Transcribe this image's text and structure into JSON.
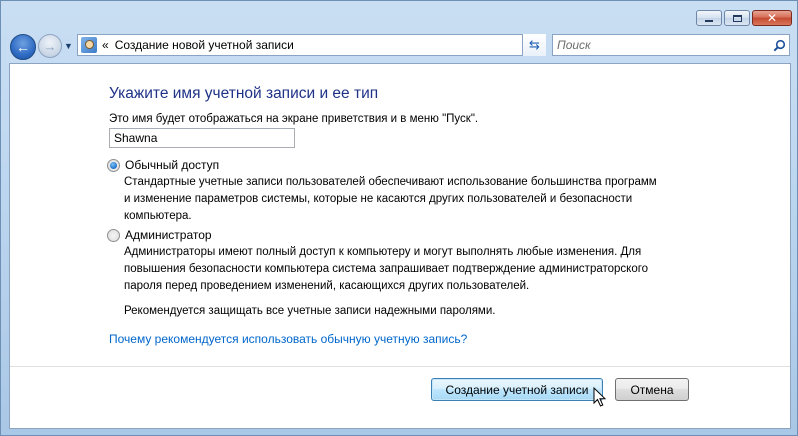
{
  "window": {
    "caption_buttons": [
      "minimize",
      "maximize",
      "close"
    ]
  },
  "navigation": {
    "address": "Создание новой учетной записи",
    "breadcrumb_chevrons": "«",
    "search_placeholder": "Поиск"
  },
  "main": {
    "title": "Укажите имя учетной записи и ее тип",
    "subtitle": "Это имя будет отображаться на экране приветствия и в меню \"Пуск\".",
    "name_value": "Shawna",
    "options": [
      {
        "label": "Обычный доступ",
        "checked": true,
        "description": [
          "Стандартные учетные записи пользователей обеспечивают использование большинства программ",
          "и изменение параметров системы, которые не касаются других пользователей и безопасности",
          "компьютера."
        ]
      },
      {
        "label": "Администратор",
        "checked": false,
        "description": [
          "Администраторы имеют полный доступ к компьютеру и могут выполнять любые изменения. Для",
          "повышения безопасности компьютера система запрашивает подтверждение администраторского",
          "пароля перед проведением изменений, касающихся других пользователей."
        ]
      }
    ],
    "recommendation": "Рекомендуется защищать все учетные записи надежными паролями.",
    "help_link": "Почему рекомендуется использовать обычную учетную запись?"
  },
  "footer": {
    "create_button": "Создание учетной записи",
    "cancel_button": "Отмена"
  },
  "colors": {
    "title": "#1e3287",
    "link": "#0066cc",
    "primary_button_border": "#3c7fb1"
  }
}
